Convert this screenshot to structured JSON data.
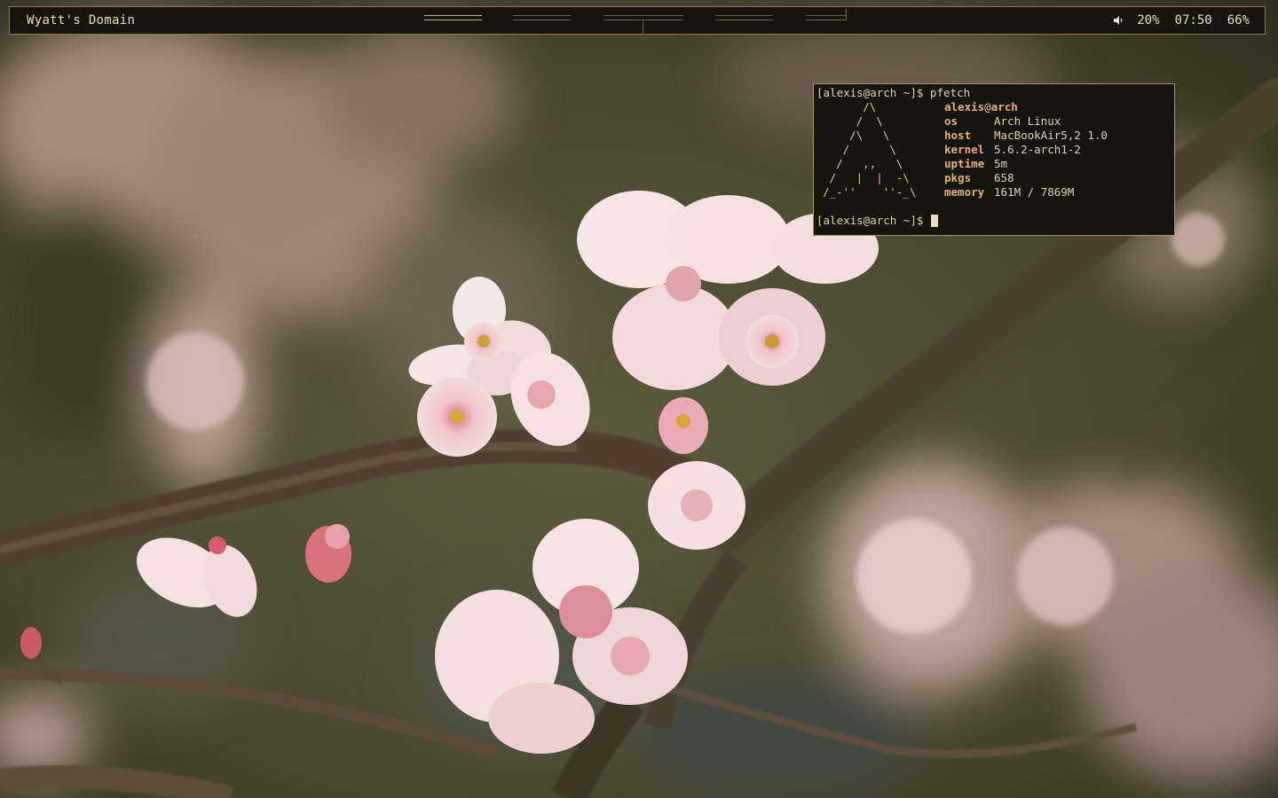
{
  "topbar": {
    "title": "Wyatt's Domain",
    "workspaces": [
      {
        "id": 1,
        "active": true
      },
      {
        "id": 2,
        "active": false
      },
      {
        "id": 3,
        "active": false
      },
      {
        "id": 4,
        "active": false
      },
      {
        "id": 5,
        "active": false
      }
    ],
    "volume_icon": "speaker-icon",
    "volume": "20%",
    "clock": "07:50",
    "battery": "66%"
  },
  "terminal": {
    "prompt_command": "[alexis@arch ~]$ pfetch",
    "ascii_logo": "      /\\\n     /  \\\n    /\\   \\\n   /      \\\n  /   ,,   \\\n /   |  |  -\\\n/_-''    ''-_\\",
    "user": "alexis",
    "at": "@",
    "host": "arch",
    "info": [
      {
        "key": "os",
        "value": "Arch Linux"
      },
      {
        "key": "host",
        "value": "MacBookAir5,2 1.0"
      },
      {
        "key": "kernel",
        "value": "5.6.2-arch1-2"
      },
      {
        "key": "uptime",
        "value": "5m"
      },
      {
        "key": "pkgs",
        "value": "658"
      },
      {
        "key": "memory",
        "value": "161M / 7869M"
      }
    ],
    "prompt": "[alexis@arch ~]$ "
  },
  "colors": {
    "bar_bg": "#15140f",
    "bar_border": "#8a7a5a",
    "text": "#e8dcc2",
    "accent": "#e4b17a",
    "terminal_border": "#a5926a"
  }
}
